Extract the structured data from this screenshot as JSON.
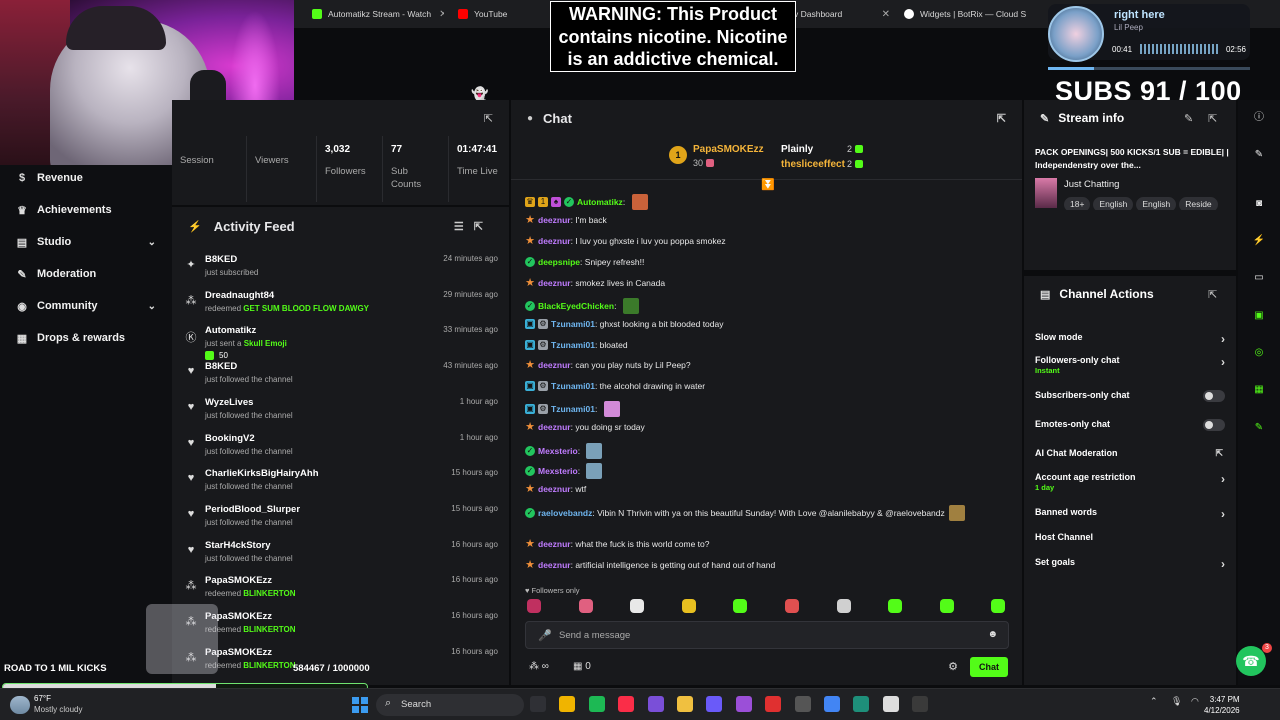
{
  "browser_tabs": [
    {
      "title": "Automatikz Stream - Watch",
      "color": "#53fc18"
    },
    {
      "title": "YouTube",
      "color": "#ff0000"
    },
    {
      "title": "v Dashboard",
      "color": "#53fc18"
    },
    {
      "title": "Widgets | BotRix — Cloud S",
      "color": "#ffffff"
    }
  ],
  "overlay": {
    "warning": "WARNING: This Product contains nicotine. Nicotine is an addictive chemical.",
    "subs": "SUBS 91 / 100",
    "road_label": "ROAD TO 1 MIL KICKS",
    "road_value": "584467 / 1000000",
    "road_progress": 0.584467
  },
  "music": {
    "song": "right here",
    "artist": "Lil Peep",
    "elapsed": "00:41",
    "total": "02:56",
    "progress": 0.23
  },
  "nav": [
    {
      "label": "Revenue",
      "icon": "dollar-icon",
      "glyph": "$",
      "chev": false
    },
    {
      "label": "Achievements",
      "icon": "trophy-icon",
      "glyph": "♛",
      "chev": false
    },
    {
      "label": "Studio",
      "icon": "studio-icon",
      "glyph": "▤",
      "chev": true
    },
    {
      "label": "Moderation",
      "icon": "wrench-icon",
      "glyph": "✎",
      "chev": false
    },
    {
      "label": "Community",
      "icon": "community-icon",
      "glyph": "◉",
      "chev": true
    },
    {
      "label": "Drops & rewards",
      "icon": "gift-icon",
      "glyph": "▦",
      "chev": false
    }
  ],
  "stats": [
    {
      "value": "",
      "label": "Session"
    },
    {
      "value": "",
      "label": "Viewers"
    },
    {
      "value": "3,032",
      "label": "Followers"
    },
    {
      "value": "77",
      "label": "Sub Counts"
    },
    {
      "value": "01:47:41",
      "label": "Time Live"
    }
  ],
  "feed": {
    "title": "Activity Feed",
    "events": [
      {
        "name": "B8KED",
        "desc": "just subscribed",
        "highlight": "",
        "time": "24 minutes ago",
        "icon": "star-icon",
        "glyph": "✦"
      },
      {
        "name": "Dreadnaught84",
        "desc": "redeemed ",
        "highlight": "GET SUM BLOOD FLOW DAWGY",
        "time": "29 minutes ago",
        "icon": "reward-icon",
        "glyph": "⁂"
      },
      {
        "name": "Automatikz",
        "desc": "just sent a ",
        "highlight": "Skull Emoji",
        "time": "33 minutes ago",
        "icon": "kick-icon",
        "glyph": "Ⓚ",
        "extra": "50"
      },
      {
        "name": "B8KED",
        "desc": "just followed the channel",
        "highlight": "",
        "time": "43 minutes ago",
        "icon": "heart-icon",
        "glyph": "♥"
      },
      {
        "name": "WyzeLives",
        "desc": "just followed the channel",
        "highlight": "",
        "time": "1 hour ago",
        "icon": "heart-icon",
        "glyph": "♥"
      },
      {
        "name": "BookingV2",
        "desc": "just followed the channel",
        "highlight": "",
        "time": "1 hour ago",
        "icon": "heart-icon",
        "glyph": "♥"
      },
      {
        "name": "CharlieKirksBigHairyAhh",
        "desc": "just followed the channel",
        "highlight": "",
        "time": "15 hours ago",
        "icon": "heart-icon",
        "glyph": "♥"
      },
      {
        "name": "PeriodBlood_Slurper",
        "desc": "just followed the channel",
        "highlight": "",
        "time": "15 hours ago",
        "icon": "heart-icon",
        "glyph": "♥"
      },
      {
        "name": "StarH4ckStory",
        "desc": "just followed the channel",
        "highlight": "",
        "time": "16 hours ago",
        "icon": "heart-icon",
        "glyph": "♥"
      },
      {
        "name": "PapaSMOKEzz",
        "desc": "redeemed ",
        "highlight": "BLINKERTON",
        "time": "16 hours ago",
        "icon": "reward-icon",
        "glyph": "⁂"
      },
      {
        "name": "PapaSMOKEzz",
        "desc": "redeemed ",
        "highlight": "BLINKERTON",
        "time": "16 hours ago",
        "icon": "reward-icon",
        "glyph": "⁂"
      },
      {
        "name": "PapaSMOKEzz",
        "desc": "redeemed ",
        "highlight": "BLINKERTON",
        "time": "16 hours ago",
        "icon": "reward-icon",
        "glyph": "⁂"
      }
    ]
  },
  "chat": {
    "title": "Chat",
    "top_gifters": [
      {
        "rank": "1",
        "name": "PapaSMOKEzz",
        "count": "30"
      },
      {
        "name": "Plainly",
        "count": "2"
      },
      {
        "name": "thesliceeffect",
        "count": "2"
      }
    ],
    "messages": [
      {
        "user": "Automatikz",
        "color": "#53fc18",
        "text": "",
        "badges": [
          "crown",
          "1",
          "kick",
          "verified"
        ],
        "emote": "#c9623a"
      },
      {
        "user": "deeznur",
        "color": "#c07cff",
        "text": "I'm back",
        "badges": [
          "star"
        ]
      },
      {
        "user": "deeznur",
        "color": "#c07cff",
        "text": "I luv you ghxste i luv you poppa smokez",
        "badges": [
          "star"
        ]
      },
      {
        "user": "deepsnipe",
        "color": "#53fc18",
        "text": "Snipey refresh!!",
        "badges": [
          "verified"
        ]
      },
      {
        "user": "deeznur",
        "color": "#c07cff",
        "text": "smokez lives in Canada",
        "badges": [
          "star"
        ]
      },
      {
        "user": "BlackEyedChicken",
        "color": "#53fc18",
        "text": "",
        "badges": [
          "verified"
        ],
        "emote": "#3b7a2a"
      },
      {
        "user": "Tzunami01",
        "color": "#6fb6f0",
        "text": "ghxst looking a bit blooded today",
        "badges": [
          "mod",
          "bot"
        ]
      },
      {
        "user": "Tzunami01",
        "color": "#6fb6f0",
        "text": "bloated",
        "badges": [
          "mod",
          "bot"
        ]
      },
      {
        "user": "deeznur",
        "color": "#c07cff",
        "text": "can you play nuts by Lil Peep?",
        "badges": [
          "star"
        ]
      },
      {
        "user": "Tzunami01",
        "color": "#6fb6f0",
        "text": "the alcohol drawing in water",
        "badges": [
          "mod",
          "bot"
        ]
      },
      {
        "user": "Tzunami01",
        "color": "#6fb6f0",
        "text": "",
        "badges": [
          "mod",
          "bot"
        ],
        "emote": "#d28ad8"
      },
      {
        "user": "deeznur",
        "color": "#c07cff",
        "text": "you doing sr today",
        "badges": [
          "star"
        ]
      },
      {
        "user": "Mexsterio",
        "color": "#c07cff",
        "text": "",
        "badges": [
          "verified"
        ],
        "emote": "#7aa0b8"
      },
      {
        "user": "Mexsterio",
        "color": "#c07cff",
        "text": "",
        "badges": [
          "verified"
        ],
        "emote": "#7aa0b8"
      },
      {
        "user": "deeznur",
        "color": "#c07cff",
        "text": "wtf",
        "badges": [
          "star"
        ]
      },
      {
        "user": "raelovebandz",
        "color": "#6fb6f0",
        "text": "Vibin N Thrivin with ya on this beautiful Sunday! With Love @alanilebabyy & @raelovebandz",
        "badges": [
          "verified"
        ],
        "emote": "#a08040"
      },
      {
        "user": "deeznur",
        "color": "#c07cff",
        "text": "what the fuck is this world come to?",
        "badges": [
          "star"
        ]
      },
      {
        "user": "deeznur",
        "color": "#c07cff",
        "text": "artificial intelligence is getting out of hand out of hand",
        "badges": [
          "star"
        ]
      }
    ],
    "followers_only": "Followers only",
    "quick_emotes": [
      "#c03060",
      "#e06080",
      "#e8e8e8",
      "#e8c020",
      "#53fc18",
      "#e05050",
      "#d0d0d0",
      "#53fc18",
      "#53fc18",
      "#53fc18"
    ],
    "input_placeholder": "Send a message",
    "points": "∞",
    "store_count": "0",
    "send_label": "Chat"
  },
  "stream_info": {
    "title": "Stream info",
    "stream_title": "PACK OPENINGS| 500 KICKS/1 SUB = EDIBLE| | Independenstry over the...",
    "category": "Just Chatting",
    "tags": [
      "18+",
      "English",
      "English",
      "Reside"
    ]
  },
  "channel_actions": {
    "title": "Channel Actions",
    "items": [
      {
        "label": "Slow mode",
        "sub": "",
        "control": "chevron"
      },
      {
        "label": "Followers-only chat",
        "sub": "Instant",
        "control": "chevron"
      },
      {
        "label": "Subscribers-only chat",
        "sub": "",
        "control": "toggle"
      },
      {
        "label": "Emotes-only chat",
        "sub": "",
        "control": "toggle"
      },
      {
        "label": "AI Chat Moderation",
        "sub": "",
        "control": "external"
      },
      {
        "label": "Account age restriction",
        "sub": "1 day",
        "control": "chevron"
      },
      {
        "label": "Banned words",
        "sub": "",
        "control": "chevron"
      },
      {
        "label": "Host Channel",
        "sub": "",
        "control": "none"
      },
      {
        "label": "Set goals",
        "sub": "",
        "control": "chevron"
      }
    ]
  },
  "taskbar": {
    "weather_temp": "67°F",
    "weather_desc": "Mostly cloudy",
    "search": "Search",
    "time": "3:47 PM",
    "date": "4/12/2026",
    "help_badge": "3",
    "apps": [
      "#2f3035",
      "#f0b400",
      "#1db954",
      "#fa2d48",
      "#7a4fd8",
      "#f0c040",
      "#6a5af9",
      "#9b4fd8",
      "#e03030",
      "#555555",
      "#4285f4",
      "#1e8f7a",
      "#dddddd",
      "#3a3a3a"
    ]
  }
}
